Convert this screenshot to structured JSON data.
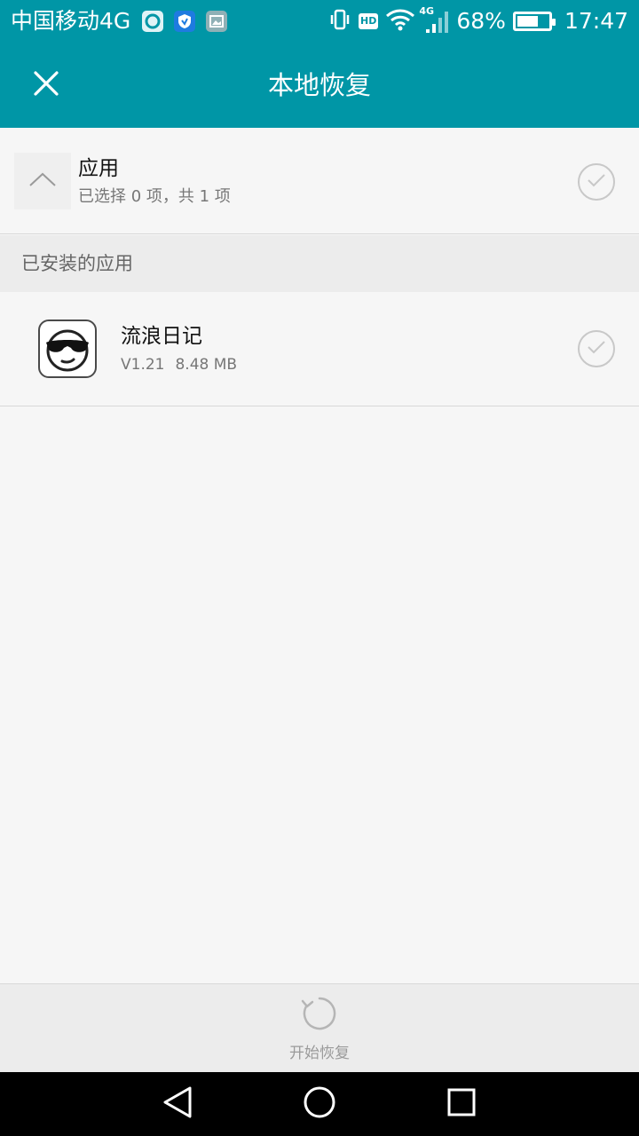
{
  "status_bar": {
    "carrier": "中国移动4G",
    "network_label": "4G",
    "hd_label": "HD",
    "battery_percent_text": "68%",
    "battery_level": 0.68,
    "time": "17:47"
  },
  "app_bar": {
    "title": "本地恢复"
  },
  "category": {
    "title": "应用",
    "subtitle": "已选择 0 项，共 1 项"
  },
  "section": {
    "title": "已安装的应用"
  },
  "apps": [
    {
      "name": "流浪日记",
      "version": "V1.21",
      "size": "8.48 MB"
    }
  ],
  "action": {
    "restore_label": "开始恢复"
  },
  "colors": {
    "accent": "#0096a6",
    "background": "#f6f6f6",
    "section_bg": "#ececec"
  },
  "icons": {
    "close": "close-icon",
    "collapse": "chevron-up-icon",
    "check": "check-icon",
    "restore": "refresh-icon",
    "nav_back": "back-triangle-icon",
    "nav_home": "home-circle-icon",
    "nav_recent": "recent-square-icon"
  }
}
